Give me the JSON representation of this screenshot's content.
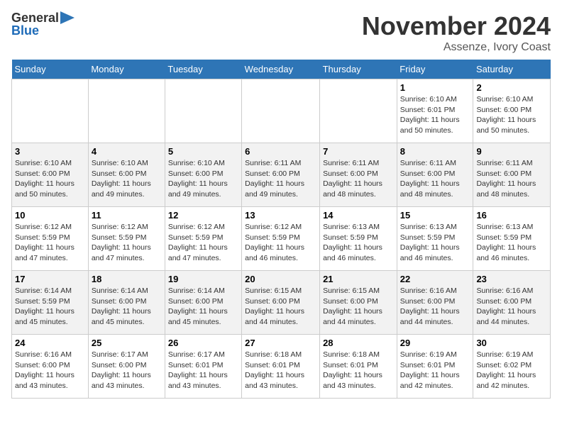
{
  "header": {
    "logo_general": "General",
    "logo_blue": "Blue",
    "title": "November 2024",
    "location": "Assenze, Ivory Coast"
  },
  "weekdays": [
    "Sunday",
    "Monday",
    "Tuesday",
    "Wednesday",
    "Thursday",
    "Friday",
    "Saturday"
  ],
  "weeks": [
    [
      {
        "day": "",
        "info": ""
      },
      {
        "day": "",
        "info": ""
      },
      {
        "day": "",
        "info": ""
      },
      {
        "day": "",
        "info": ""
      },
      {
        "day": "",
        "info": ""
      },
      {
        "day": "1",
        "info": "Sunrise: 6:10 AM\nSunset: 6:01 PM\nDaylight: 11 hours\nand 50 minutes."
      },
      {
        "day": "2",
        "info": "Sunrise: 6:10 AM\nSunset: 6:00 PM\nDaylight: 11 hours\nand 50 minutes."
      }
    ],
    [
      {
        "day": "3",
        "info": "Sunrise: 6:10 AM\nSunset: 6:00 PM\nDaylight: 11 hours\nand 50 minutes."
      },
      {
        "day": "4",
        "info": "Sunrise: 6:10 AM\nSunset: 6:00 PM\nDaylight: 11 hours\nand 49 minutes."
      },
      {
        "day": "5",
        "info": "Sunrise: 6:10 AM\nSunset: 6:00 PM\nDaylight: 11 hours\nand 49 minutes."
      },
      {
        "day": "6",
        "info": "Sunrise: 6:11 AM\nSunset: 6:00 PM\nDaylight: 11 hours\nand 49 minutes."
      },
      {
        "day": "7",
        "info": "Sunrise: 6:11 AM\nSunset: 6:00 PM\nDaylight: 11 hours\nand 48 minutes."
      },
      {
        "day": "8",
        "info": "Sunrise: 6:11 AM\nSunset: 6:00 PM\nDaylight: 11 hours\nand 48 minutes."
      },
      {
        "day": "9",
        "info": "Sunrise: 6:11 AM\nSunset: 6:00 PM\nDaylight: 11 hours\nand 48 minutes."
      }
    ],
    [
      {
        "day": "10",
        "info": "Sunrise: 6:12 AM\nSunset: 5:59 PM\nDaylight: 11 hours\nand 47 minutes."
      },
      {
        "day": "11",
        "info": "Sunrise: 6:12 AM\nSunset: 5:59 PM\nDaylight: 11 hours\nand 47 minutes."
      },
      {
        "day": "12",
        "info": "Sunrise: 6:12 AM\nSunset: 5:59 PM\nDaylight: 11 hours\nand 47 minutes."
      },
      {
        "day": "13",
        "info": "Sunrise: 6:12 AM\nSunset: 5:59 PM\nDaylight: 11 hours\nand 46 minutes."
      },
      {
        "day": "14",
        "info": "Sunrise: 6:13 AM\nSunset: 5:59 PM\nDaylight: 11 hours\nand 46 minutes."
      },
      {
        "day": "15",
        "info": "Sunrise: 6:13 AM\nSunset: 5:59 PM\nDaylight: 11 hours\nand 46 minutes."
      },
      {
        "day": "16",
        "info": "Sunrise: 6:13 AM\nSunset: 5:59 PM\nDaylight: 11 hours\nand 46 minutes."
      }
    ],
    [
      {
        "day": "17",
        "info": "Sunrise: 6:14 AM\nSunset: 5:59 PM\nDaylight: 11 hours\nand 45 minutes."
      },
      {
        "day": "18",
        "info": "Sunrise: 6:14 AM\nSunset: 6:00 PM\nDaylight: 11 hours\nand 45 minutes."
      },
      {
        "day": "19",
        "info": "Sunrise: 6:14 AM\nSunset: 6:00 PM\nDaylight: 11 hours\nand 45 minutes."
      },
      {
        "day": "20",
        "info": "Sunrise: 6:15 AM\nSunset: 6:00 PM\nDaylight: 11 hours\nand 44 minutes."
      },
      {
        "day": "21",
        "info": "Sunrise: 6:15 AM\nSunset: 6:00 PM\nDaylight: 11 hours\nand 44 minutes."
      },
      {
        "day": "22",
        "info": "Sunrise: 6:16 AM\nSunset: 6:00 PM\nDaylight: 11 hours\nand 44 minutes."
      },
      {
        "day": "23",
        "info": "Sunrise: 6:16 AM\nSunset: 6:00 PM\nDaylight: 11 hours\nand 44 minutes."
      }
    ],
    [
      {
        "day": "24",
        "info": "Sunrise: 6:16 AM\nSunset: 6:00 PM\nDaylight: 11 hours\nand 43 minutes."
      },
      {
        "day": "25",
        "info": "Sunrise: 6:17 AM\nSunset: 6:00 PM\nDaylight: 11 hours\nand 43 minutes."
      },
      {
        "day": "26",
        "info": "Sunrise: 6:17 AM\nSunset: 6:01 PM\nDaylight: 11 hours\nand 43 minutes."
      },
      {
        "day": "27",
        "info": "Sunrise: 6:18 AM\nSunset: 6:01 PM\nDaylight: 11 hours\nand 43 minutes."
      },
      {
        "day": "28",
        "info": "Sunrise: 6:18 AM\nSunset: 6:01 PM\nDaylight: 11 hours\nand 43 minutes."
      },
      {
        "day": "29",
        "info": "Sunrise: 6:19 AM\nSunset: 6:01 PM\nDaylight: 11 hours\nand 42 minutes."
      },
      {
        "day": "30",
        "info": "Sunrise: 6:19 AM\nSunset: 6:02 PM\nDaylight: 11 hours\nand 42 minutes."
      }
    ]
  ]
}
